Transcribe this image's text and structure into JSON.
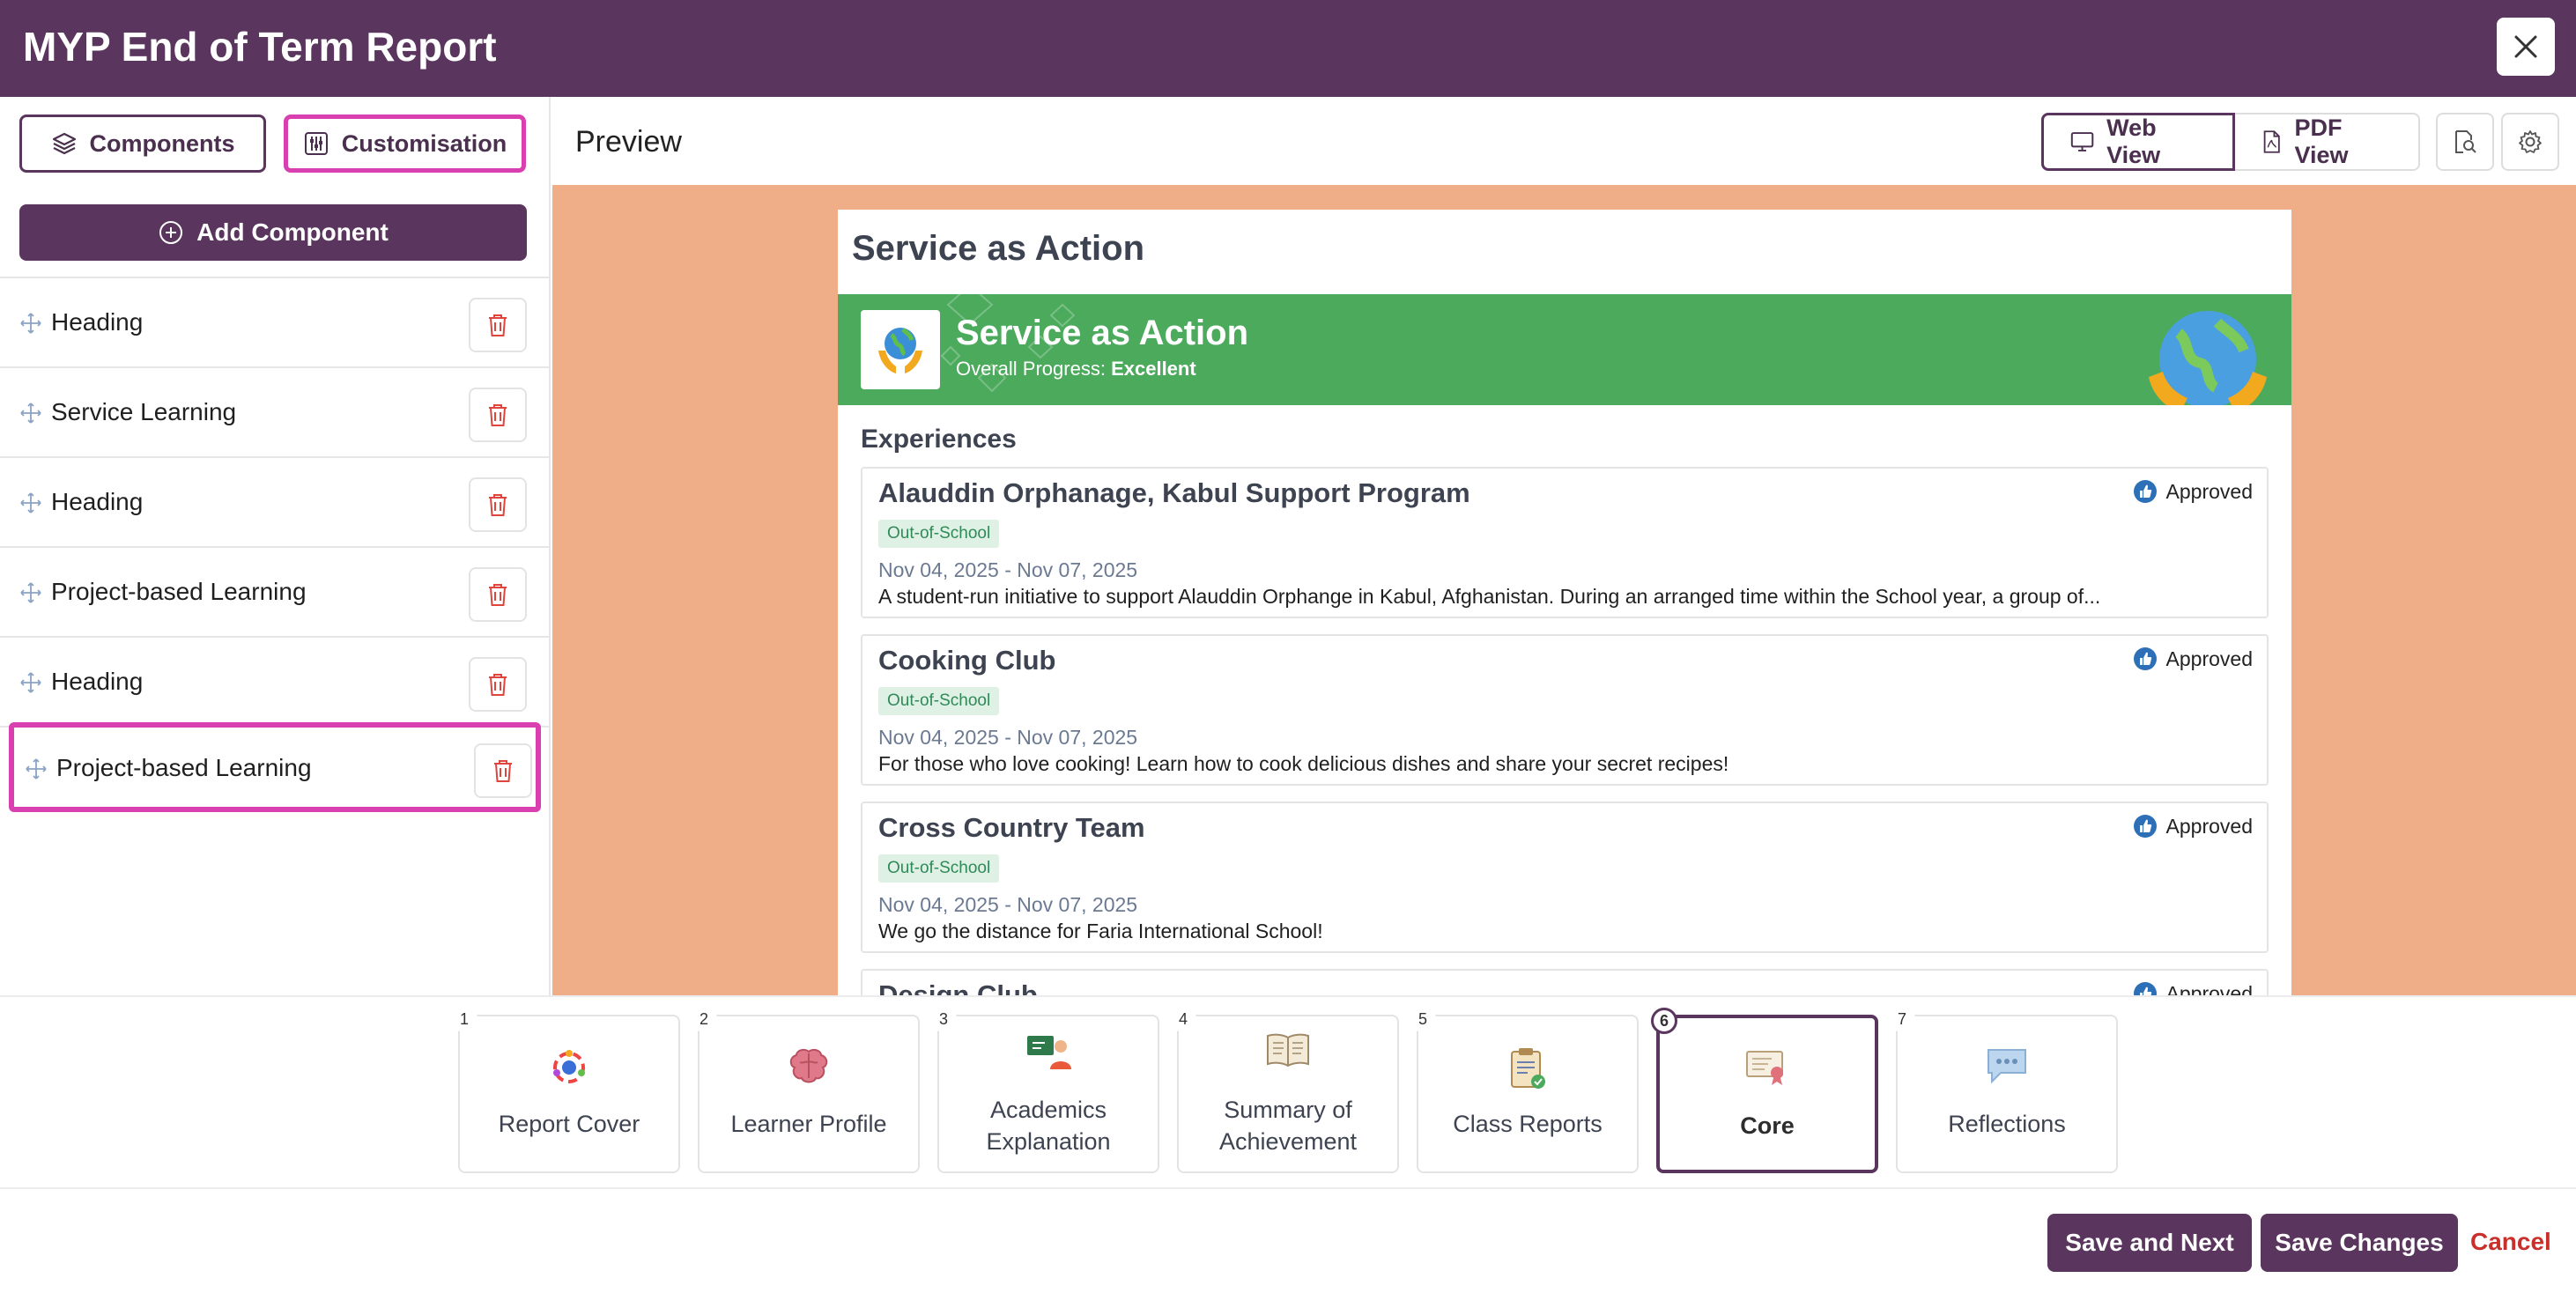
{
  "header": {
    "title": "MYP End of Term Report"
  },
  "sidebar": {
    "tabs": {
      "components": "Components",
      "customisation": "Customisation"
    },
    "add_component": "Add Component",
    "items": [
      {
        "label": "Heading"
      },
      {
        "label": "Service Learning"
      },
      {
        "label": "Heading"
      },
      {
        "label": "Project-based Learning"
      },
      {
        "label": "Heading"
      },
      {
        "label": "Project-based Learning"
      }
    ]
  },
  "preview": {
    "title": "Preview",
    "web_view": "Web View",
    "pdf_view": "PDF View",
    "section_title": "Service as Action",
    "banner": {
      "title": "Service as Action",
      "progress_label": "Overall Progress:",
      "progress_value": "Excellent"
    },
    "experiences_title": "Experiences",
    "experiences": [
      {
        "name": "Alauddin Orphanage, Kabul Support Program",
        "status": "Approved",
        "tag": "Out-of-School",
        "dates": "Nov 04, 2025 - Nov 07, 2025",
        "description": "A student-run initiative to support Alauddin Orphange in Kabul, Afghanistan. During an arranged time within the School year, a group of..."
      },
      {
        "name": "Cooking Club",
        "status": "Approved",
        "tag": "Out-of-School",
        "dates": "Nov 04, 2025 - Nov 07, 2025",
        "description": "For those who love cooking! Learn how to cook delicious dishes and share your secret recipes!"
      },
      {
        "name": "Cross Country Team",
        "status": "Approved",
        "tag": "Out-of-School",
        "dates": "Nov 04, 2025 - Nov 07, 2025",
        "description": "We go the distance for Faria International School!"
      },
      {
        "name": "Design Club",
        "status": "Approved",
        "tag": "",
        "dates": "",
        "description": ""
      }
    ]
  },
  "steps": [
    {
      "num": "1",
      "label": "Report Cover",
      "icon": "report-cover-icon"
    },
    {
      "num": "2",
      "label": "Learner Profile",
      "icon": "brain-icon"
    },
    {
      "num": "3",
      "label": "Academics Explanation",
      "icon": "teacher-icon"
    },
    {
      "num": "4",
      "label": "Summary of Achievement",
      "icon": "book-icon"
    },
    {
      "num": "5",
      "label": "Class Reports",
      "icon": "clipboard-icon"
    },
    {
      "num": "6",
      "label": "Core",
      "icon": "certificate-icon"
    },
    {
      "num": "7",
      "label": "Reflections",
      "icon": "speech-bubble-icon"
    }
  ],
  "footer": {
    "save_next": "Save and Next",
    "save_changes": "Save Changes",
    "cancel": "Cancel"
  },
  "colors": {
    "brand": "#5a355e",
    "highlight": "#d93fae",
    "canvas_bg": "#efae87",
    "banner_green": "#4caa5c",
    "cancel_red": "#c9302c"
  }
}
